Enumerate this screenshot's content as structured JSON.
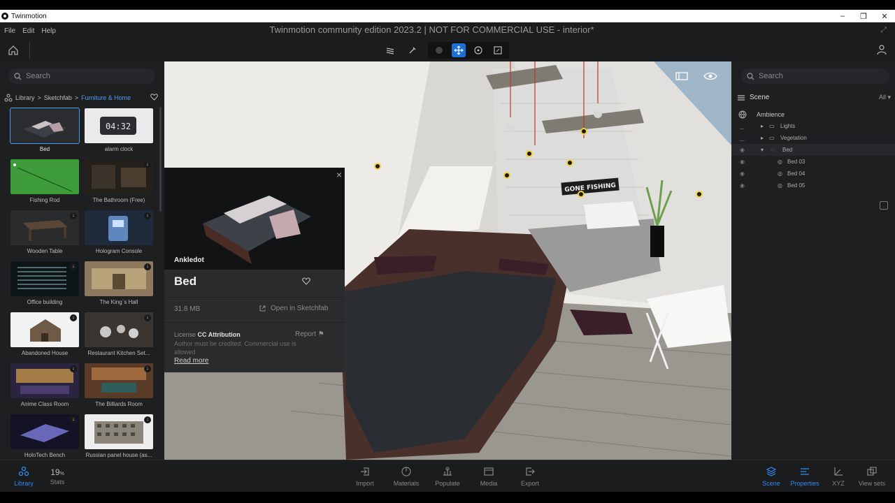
{
  "window": {
    "app_name": "Twinmotion",
    "minimize": "–",
    "maximize": "❐",
    "close": "✕"
  },
  "menu": {
    "file": "File",
    "edit": "Edit",
    "help": "Help"
  },
  "document_title": "Twinmotion community edition 2023.2 | NOT FOR COMMERCIAL USE - interior*",
  "left": {
    "search_placeholder": "Search",
    "breadcrumb": {
      "root": "Library",
      "sep1": ">",
      "mid": "Sketchfab",
      "sep2": ">",
      "current": "Furniture & Home"
    },
    "items": [
      {
        "label": "Bed"
      },
      {
        "label": "alarm clock",
        "clock_text": "04:32"
      },
      {
        "label": "Fishing Rod"
      },
      {
        "label": "The Bathroom (Free)"
      },
      {
        "label": "Wooden Table"
      },
      {
        "label": "Hologram Console"
      },
      {
        "label": "Office building"
      },
      {
        "label": "The King`s Hall"
      },
      {
        "label": "Abandoned House"
      },
      {
        "label": "Restaurant Kitchen Set..."
      },
      {
        "label": "Anime Class Room"
      },
      {
        "label": "The Billiards Room"
      },
      {
        "label": "HoloTech Bench"
      },
      {
        "label": "Russian panel house (as..."
      }
    ]
  },
  "popup": {
    "author": "Ankledot",
    "title": "Bed",
    "size": "31.8 MB",
    "open_link": "Open in Sketchfab",
    "license_label": "License",
    "license_value": "CC Attribution",
    "report": "Report",
    "note": "Author must be credited. Commercial use is allowed",
    "read_more": "Read more",
    "close": "×"
  },
  "viewport": {
    "sign_text": "GONE FISHING"
  },
  "right": {
    "search_placeholder": "Search",
    "scene_label": "Scene",
    "filter": "All",
    "tree": [
      {
        "label": "Ambience"
      },
      {
        "label": "Lights"
      },
      {
        "label": "Vegetation"
      },
      {
        "label": "Bed"
      },
      {
        "label": "Bed 03"
      },
      {
        "label": "Bed 04"
      },
      {
        "label": "Bed 05"
      }
    ]
  },
  "bottom": {
    "library": "Library",
    "stats_value": "19",
    "stats_unit": "%",
    "stats": "Stats",
    "import": "Import",
    "materials": "Materials",
    "populate": "Populate",
    "media": "Media",
    "export": "Export",
    "scene": "Scene",
    "properties": "Properties",
    "xyz": "XYZ",
    "viewsets": "View sets"
  },
  "colors": {
    "accent": "#2f8cf0",
    "panel": "#1e1f21",
    "toolbar": "#1b1c1e"
  }
}
